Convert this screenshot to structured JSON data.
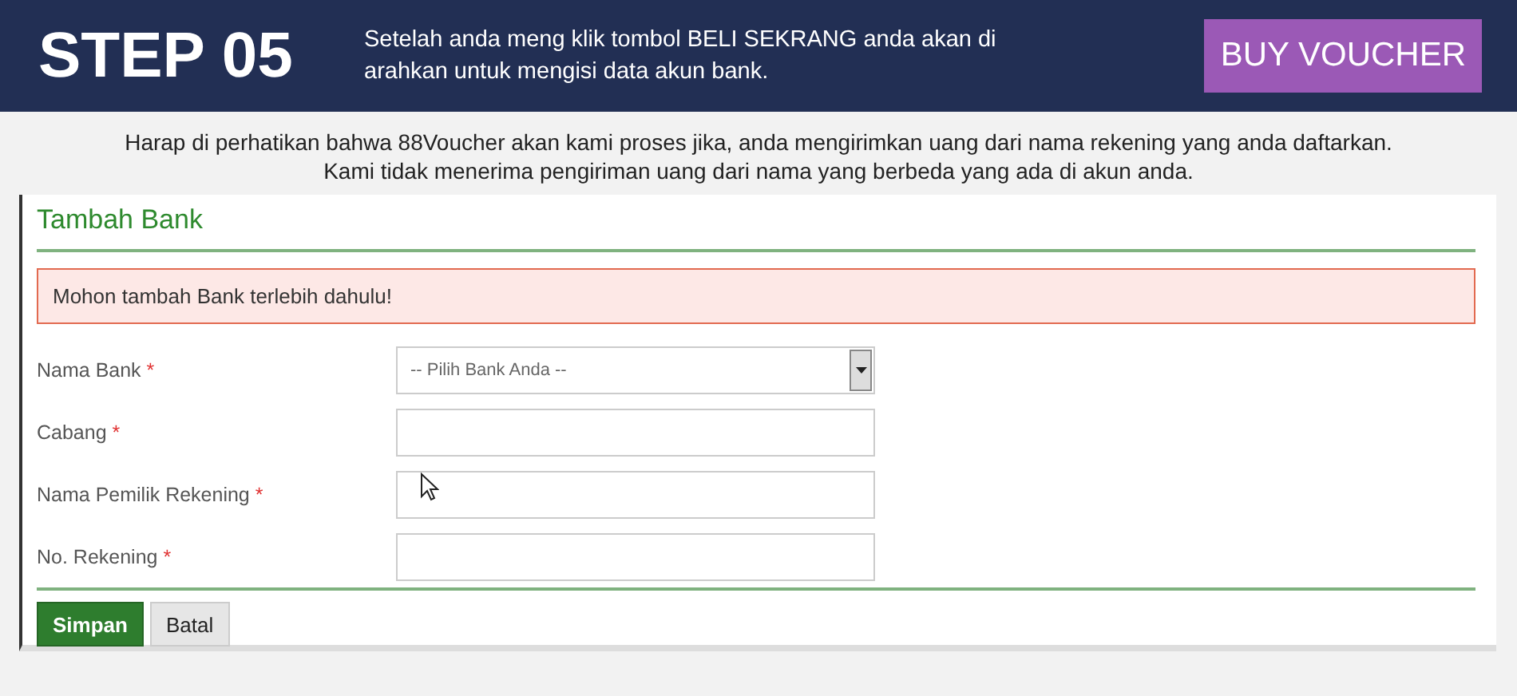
{
  "header": {
    "step": "STEP 05",
    "description": "Setelah anda meng klik tombol BELI SEKRANG anda akan di arahkan untuk mengisi data akun bank.",
    "button": "BUY VOUCHER"
  },
  "notice": [
    "Harap di perhatikan bahwa 88Voucher akan kami proses jika, anda mengirimkan uang dari nama rekening yang anda daftarkan.",
    "Kami tidak menerima pengiriman uang dari nama yang berbeda yang ada di akun anda."
  ],
  "form": {
    "title": "Tambah Bank",
    "alert": "Mohon tambah Bank terlebih dahulu!",
    "fields": [
      {
        "kind": "select",
        "label": "Nama Bank",
        "required_mark": "*",
        "placeholder": "-- Pilih Bank Anda --"
      },
      {
        "kind": "text",
        "label": "Cabang",
        "required_mark": "*"
      },
      {
        "kind": "text",
        "label": "Nama Pemilik Rekening",
        "required_mark": "*"
      },
      {
        "kind": "text",
        "label": "No. Rekening",
        "required_mark": "*"
      }
    ],
    "buttons": [
      {
        "label": "Simpan",
        "kind": "primary"
      },
      {
        "label": "Batal",
        "kind": "secondary"
      }
    ]
  }
}
